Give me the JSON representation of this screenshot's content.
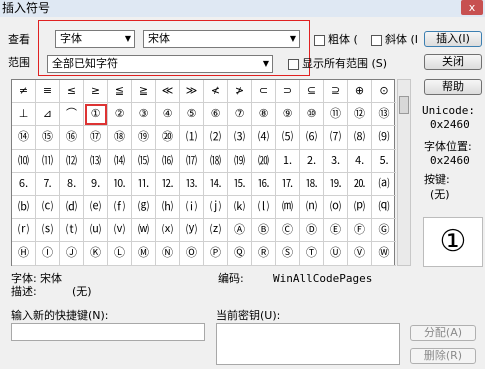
{
  "window": {
    "title": "插入符号",
    "close_glyph": "x"
  },
  "view": {
    "label": "查看",
    "font_type": "字体",
    "font_name": "宋体",
    "bold_label": "粗体 (",
    "italic_label": "斜体 (I"
  },
  "range": {
    "label": "范围",
    "value": "全部已知字符",
    "show_all_label": "显示所有范围 (S)"
  },
  "buttons": {
    "insert": "插入(I)",
    "close": "关闭",
    "help": "帮助",
    "assign": "分配(A)",
    "delete": "删除(R)"
  },
  "info": {
    "unicode_label": "Unicode:",
    "unicode_value": "0x2460",
    "font_pos_label": "字体位置:",
    "font_pos_value": "0x2460",
    "key_label": "按键:",
    "key_value": "(无)",
    "preview_char": "①"
  },
  "bottom": {
    "font_label": "字体:",
    "font_value": "宋体",
    "desc_label": "描述:",
    "desc_value": "(无)",
    "encoding_label": "编码:",
    "encoding_value": "WinAllCodePages",
    "new_shortcut_label": "输入新的快捷键(N):",
    "current_key_label": "当前密钥(U):"
  },
  "symbols": [
    "≠",
    "≡",
    "≤",
    "≥",
    "≦",
    "≧",
    "≪",
    "≫",
    "≮",
    "≯",
    "⊂",
    "⊃",
    "⊆",
    "⊇",
    "⊕",
    "⊙",
    "⊥",
    "⊿",
    "⌒",
    "①",
    "②",
    "③",
    "④",
    "⑤",
    "⑥",
    "⑦",
    "⑧",
    "⑨",
    "⑩",
    "⑪",
    "⑫",
    "⑬",
    "⑭",
    "⑮",
    "⑯",
    "⑰",
    "⑱",
    "⑲",
    "⑳",
    "⑴",
    "⑵",
    "⑶",
    "⑷",
    "⑸",
    "⑹",
    "⑺",
    "⑻",
    "⑼",
    "⑽",
    "⑾",
    "⑿",
    "⒀",
    "⒁",
    "⒂",
    "⒃",
    "⒄",
    "⒅",
    "⒆",
    "⒇",
    "⒈",
    "⒉",
    "⒊",
    "⒋",
    "⒌",
    "⒍",
    "⒎",
    "⒏",
    "⒐",
    "⒑",
    "⒒",
    "⒓",
    "⒔",
    "⒕",
    "⒖",
    "⒗",
    "⒘",
    "⒙",
    "⒚",
    "⒛",
    "⒜",
    "⒝",
    "⒞",
    "⒟",
    "⒠",
    "⒡",
    "⒢",
    "⒣",
    "⒤",
    "⒥",
    "⒦",
    "⒧",
    "⒨",
    "⒩",
    "⒪",
    "⒫",
    "⒬",
    "⒭",
    "⒮",
    "⒯",
    "⒰",
    "⒱",
    "⒲",
    "⒳",
    "⒴",
    "⒵",
    "Ⓐ",
    "Ⓑ",
    "Ⓒ",
    "Ⓓ",
    "Ⓔ",
    "Ⓕ",
    "Ⓖ",
    "Ⓗ",
    "Ⓘ",
    "Ⓙ",
    "Ⓚ",
    "Ⓛ",
    "Ⓜ",
    "Ⓝ",
    "Ⓞ",
    "Ⓟ",
    "Ⓠ",
    "Ⓡ",
    "Ⓢ",
    "Ⓣ",
    "Ⓤ",
    "Ⓥ",
    "Ⓦ"
  ],
  "selected_symbol": "①",
  "colors": {
    "highlight": "#e02020",
    "title_bar": "#dfe8f3",
    "close": "#c75050"
  }
}
